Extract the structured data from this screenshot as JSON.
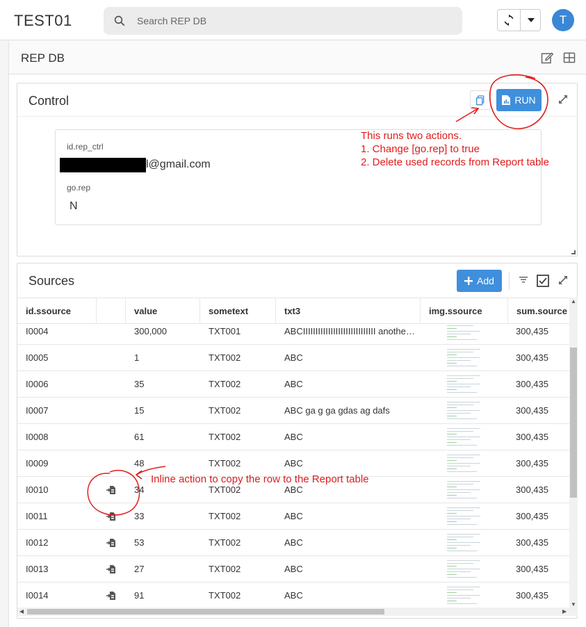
{
  "app": {
    "title": "TEST01",
    "avatar_letter": "T"
  },
  "search": {
    "placeholder": "Search REP DB"
  },
  "page": {
    "title": "REP DB"
  },
  "control": {
    "title": "Control",
    "run_label": "RUN",
    "fields": [
      {
        "label": "id.rep_ctrl",
        "value": "l@gmail.com"
      },
      {
        "label": "go.rep",
        "value": "N"
      }
    ],
    "annotation": [
      "This runs two actions.",
      "1. Change [go.rep] to true",
      "2. Delete used records from Report table"
    ]
  },
  "sources": {
    "title": "Sources",
    "add_label": "Add",
    "columns": [
      "id.ssource",
      "",
      "value",
      "sometext",
      "txt3",
      "img.ssource",
      "sum.source"
    ],
    "rows": [
      {
        "id": "I0004",
        "value": "300,000",
        "sometext": "TXT001",
        "txt3": "ABCIIIIIIIIIIIIIIIIIIIIIIIIIIIII another li…",
        "sum": "300,435",
        "copy": false
      },
      {
        "id": "I0005",
        "value": "1",
        "sometext": "TXT002",
        "txt3": "ABC",
        "sum": "300,435",
        "copy": false
      },
      {
        "id": "I0006",
        "value": "35",
        "sometext": "TXT002",
        "txt3": "ABC",
        "sum": "300,435",
        "copy": false
      },
      {
        "id": "I0007",
        "value": "15",
        "sometext": "TXT002",
        "txt3": "ABC ga g ga gdas ag dafs",
        "sum": "300,435",
        "copy": false
      },
      {
        "id": "I0008",
        "value": "61",
        "sometext": "TXT002",
        "txt3": "ABC",
        "sum": "300,435",
        "copy": false
      },
      {
        "id": "I0009",
        "value": "48",
        "sometext": "TXT002",
        "txt3": "ABC",
        "sum": "300,435",
        "copy": false
      },
      {
        "id": "I0010",
        "value": "34",
        "sometext": "TXT002",
        "txt3": "ABC",
        "sum": "300,435",
        "copy": true
      },
      {
        "id": "I0011",
        "value": "33",
        "sometext": "TXT002",
        "txt3": "ABC",
        "sum": "300,435",
        "copy": true
      },
      {
        "id": "I0012",
        "value": "53",
        "sometext": "TXT002",
        "txt3": "ABC",
        "sum": "300,435",
        "copy": true
      },
      {
        "id": "I0013",
        "value": "27",
        "sometext": "TXT002",
        "txt3": "ABC",
        "sum": "300,435",
        "copy": true
      },
      {
        "id": "I0014",
        "value": "91",
        "sometext": "TXT002",
        "txt3": "ABC",
        "sum": "300,435",
        "copy": true
      }
    ],
    "annotation": "Inline action to copy the row to the Report table"
  },
  "colors": {
    "accent": "#3f8fdc",
    "avatar": "#3a87d6",
    "annotation": "#e01c1c"
  },
  "icons": [
    "search-icon",
    "refresh-icon",
    "chevron-down-icon",
    "edit-icon",
    "grid-icon",
    "copy-icon",
    "report-icon",
    "expand-icon",
    "plus-icon",
    "filter-icon",
    "checkbox-icon",
    "row-copy-icon"
  ]
}
